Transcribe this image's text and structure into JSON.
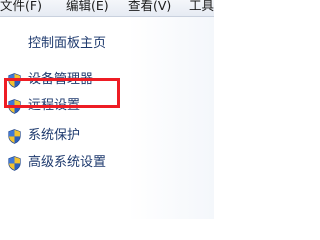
{
  "menubar": {
    "items": [
      {
        "label": "文件(F)"
      },
      {
        "label": "编辑(E)"
      },
      {
        "label": "查看(V)"
      },
      {
        "label": "工具"
      }
    ]
  },
  "pane": {
    "home_link": "控制面板主页",
    "tasks": [
      {
        "label": "设备管理器",
        "icon": "uac-shield-icon"
      },
      {
        "label": "远程设置",
        "icon": "uac-shield-icon"
      },
      {
        "label": "系统保护",
        "icon": "uac-shield-icon"
      },
      {
        "label": "高级系统设置",
        "icon": "uac-shield-icon"
      }
    ]
  },
  "annotation": {
    "highlight_color": "#ee1c24"
  }
}
